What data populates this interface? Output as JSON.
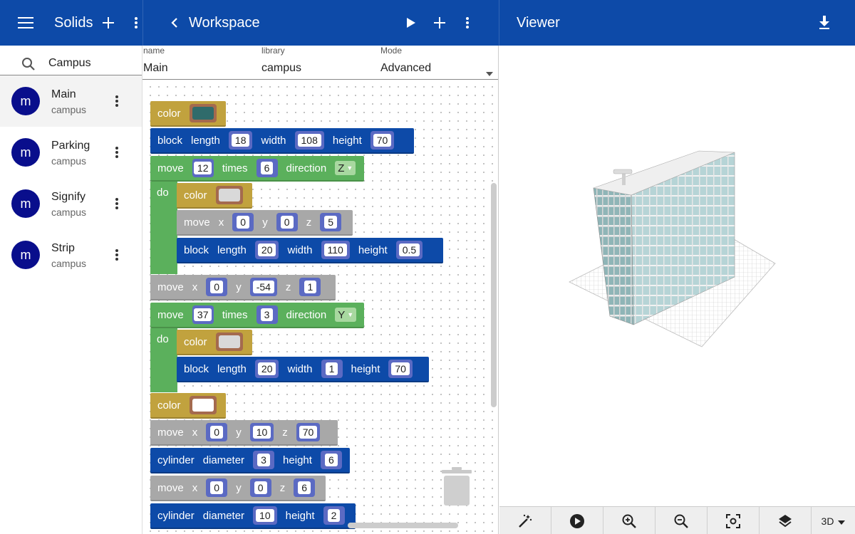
{
  "left": {
    "title": "Solids",
    "search_value": "Campus",
    "items": [
      {
        "avatar": "m",
        "name": "Main",
        "library": "campus"
      },
      {
        "avatar": "m",
        "name": "Parking",
        "library": "campus"
      },
      {
        "avatar": "m",
        "name": "Signify",
        "library": "campus"
      },
      {
        "avatar": "m",
        "name": "Strip",
        "library": "campus"
      }
    ]
  },
  "middle": {
    "title": "Workspace",
    "fields": {
      "name_label": "name",
      "name_value": "Main",
      "library_label": "library",
      "library_value": "campus",
      "mode_label": "Mode",
      "mode_value": "Advanced"
    },
    "blocks": {
      "color1": "color",
      "block1": {
        "kw": "block",
        "length_l": "length",
        "length": "18",
        "width_l": "width",
        "width": "108",
        "height_l": "height",
        "height": "70"
      },
      "move1": {
        "kw": "move",
        "count": "12",
        "times_l": "times",
        "times": "6",
        "dir_l": "direction",
        "dir": "Z"
      },
      "do1": "do",
      "color2": "color",
      "move2": {
        "kw": "move",
        "x_l": "x",
        "x": "0",
        "y_l": "y",
        "y": "0",
        "z_l": "z",
        "z": "5"
      },
      "block2": {
        "kw": "block",
        "length_l": "length",
        "length": "20",
        "width_l": "width",
        "width": "110",
        "height_l": "height",
        "height": "0.5"
      },
      "move3": {
        "kw": "move",
        "x_l": "x",
        "x": "0",
        "y_l": "y",
        "y": "-54",
        "z_l": "z",
        "z": "1"
      },
      "move4": {
        "kw": "move",
        "count": "37",
        "times_l": "times",
        "times": "3",
        "dir_l": "direction",
        "dir": "Y"
      },
      "do2": "do",
      "color3": "color",
      "block3": {
        "kw": "block",
        "length_l": "length",
        "length": "20",
        "width_l": "width",
        "width": "1",
        "height_l": "height",
        "height": "70"
      },
      "color4": "color",
      "move5": {
        "kw": "move",
        "x_l": "x",
        "x": "0",
        "y_l": "y",
        "y": "10",
        "z_l": "z",
        "z": "70"
      },
      "cyl1": {
        "kw": "cylinder",
        "d_l": "diameter",
        "d": "3",
        "h_l": "height",
        "h": "6"
      },
      "move6": {
        "kw": "move",
        "x_l": "x",
        "x": "0",
        "y_l": "y",
        "y": "0",
        "z_l": "z",
        "z": "6"
      },
      "cyl2": {
        "kw": "cylinder",
        "d_l": "diameter",
        "d": "10",
        "h_l": "height",
        "h": "2"
      }
    },
    "swatches": {
      "color1": "#2f6b6b",
      "color2": "#d9d9d9",
      "color3": "#d9d9d9",
      "color4": "#ffffff"
    }
  },
  "right": {
    "title": "Viewer",
    "view_mode": "3D",
    "icons": [
      "download-icon",
      "magic-wand-icon",
      "play-circle-icon",
      "zoom-in-icon",
      "zoom-out-icon",
      "fit-view-icon",
      "layers-icon"
    ]
  },
  "colors": {
    "appbar": "#0d4aa8",
    "avatar": "#090e8c",
    "block_blue": "#0d4aa8",
    "block_green": "#5bb05c",
    "block_gold": "#c1a23e",
    "block_gray": "#a8a8a8"
  }
}
